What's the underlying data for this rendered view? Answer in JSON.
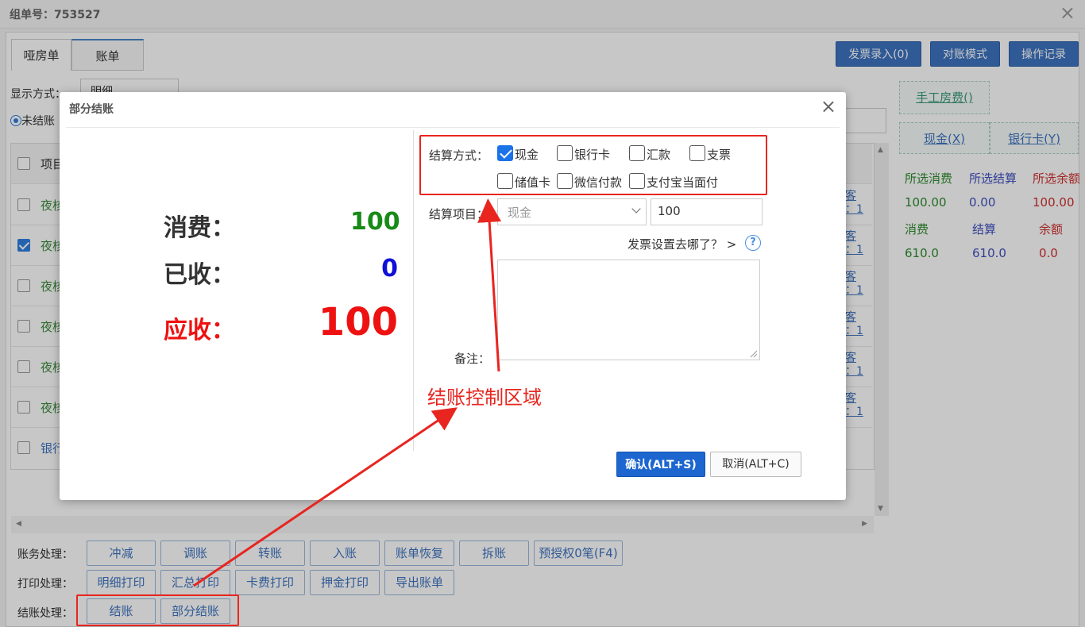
{
  "header": {
    "order_label": "组单号：753527",
    "close_glyph": "×"
  },
  "tabs": [
    {
      "label": "哑房单"
    },
    {
      "label": "账单"
    }
  ],
  "top_buttons": [
    {
      "label": "发票录入(0)"
    },
    {
      "label": "对账模式"
    },
    {
      "label": "操作记录"
    }
  ],
  "filters": {
    "display_label": "显示方式：",
    "display_value": "明细",
    "unsettled_label": "未结账"
  },
  "grid": {
    "header_text": "项目",
    "rows": [
      {
        "text": "夜核",
        "right": "客",
        "right2": "：1",
        "checked": false
      },
      {
        "text": "夜核",
        "right": "客",
        "right2": "：1",
        "checked": true
      },
      {
        "text": "夜核",
        "right": "客",
        "right2": "：1",
        "checked": false
      },
      {
        "text": "夜核",
        "right": "客",
        "right2": "：1",
        "checked": false
      },
      {
        "text": "夜核",
        "right": "客",
        "right2": "：1",
        "checked": false
      },
      {
        "text": "夜核",
        "right": "客",
        "right2": "：1",
        "checked": false
      },
      {
        "text": "银行",
        "right": "",
        "right2": "",
        "checked": false
      }
    ]
  },
  "sidebar": {
    "manual_fee": "手工房费()",
    "cash": "现金(X)",
    "bank_card": "银行卡(Y)",
    "labels1": [
      "所选消费",
      "所选结算",
      "所选余额"
    ],
    "values1": [
      "100.00",
      "0.00",
      "100.00"
    ],
    "labels2": [
      "消费",
      "结算",
      "余额"
    ],
    "values2": [
      "610.0",
      "610.0",
      "0.0"
    ]
  },
  "actions": {
    "account_label": "账务处理：",
    "account_buttons": [
      "冲减",
      "调账",
      "转账",
      "入账",
      "账单恢复",
      "拆账",
      "预授权0笔(F4)"
    ],
    "print_label": "打印处理：",
    "print_buttons": [
      "明细打印",
      "汇总打印",
      "卡费打印",
      "押金打印",
      "导出账单"
    ],
    "settle_label": "结账处理：",
    "settle_buttons": [
      "结账",
      "部分结账"
    ]
  },
  "dialog": {
    "title": "部分结账",
    "close_glyph": "×",
    "consume_label": "消费：",
    "consume_value": "100",
    "received_label": "已收：",
    "received_value": "0",
    "due_label": "应收：",
    "due_value": "100",
    "pay_method_label": "结算方式：",
    "pay_methods": [
      {
        "label": "现金",
        "checked": true
      },
      {
        "label": "银行卡",
        "checked": false
      },
      {
        "label": "汇款",
        "checked": false
      },
      {
        "label": "支票",
        "checked": false
      },
      {
        "label": "储值卡",
        "checked": false
      },
      {
        "label": "微信付款",
        "checked": false
      },
      {
        "label": "支付宝当面付",
        "checked": false
      }
    ],
    "item_label": "结算项目：",
    "item_select": "现金",
    "amount_value": "100",
    "invoice_link": "发票设置去哪了？ >",
    "help_glyph": "?",
    "remark_label": "备注：",
    "confirm_label": "确认(ALT+S)",
    "cancel_label": "取消(ALT+C)"
  },
  "annotation": {
    "text": "结账控制区域",
    "color": "#e8251f"
  },
  "colors": {
    "consume": "#178a17",
    "received": "#1010d8",
    "due": "#ee1111",
    "primary": "#1d66cf"
  }
}
